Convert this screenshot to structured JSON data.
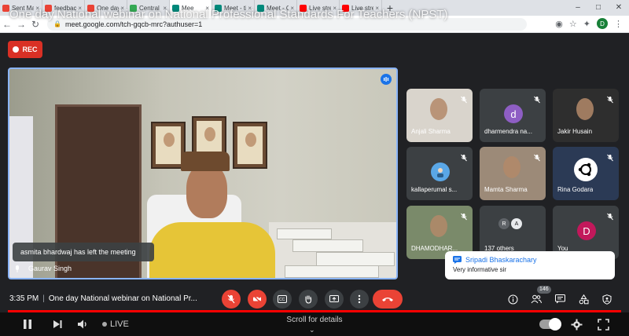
{
  "browser": {
    "tabs": [
      {
        "label": "Sent Ma",
        "color": "#ea4335"
      },
      {
        "label": "feedbac",
        "color": "#ea4335"
      },
      {
        "label": "One day",
        "color": "#ea4335"
      },
      {
        "label": "Central",
        "color": "#34a853"
      },
      {
        "label": "Mee",
        "color": "#00897b"
      },
      {
        "label": "Meet - ti",
        "color": "#00897b"
      },
      {
        "label": "Meet - C",
        "color": "#00897b"
      },
      {
        "label": "Live stre",
        "color": "#ff0000"
      },
      {
        "label": "Live stre",
        "color": "#ff0000"
      }
    ],
    "new_tab": "+",
    "url": "meet.google.com/tch-gqcb-mrc?authuser=1",
    "profile_initial": "D"
  },
  "overlay_title": "One day National webinar on National Professional Standards For Teachers (NPST)",
  "meet": {
    "rec_label": "REC",
    "main_speaker": "Gaurav Singh",
    "toast": "asmita bhardwaj has left the meeting",
    "participants": [
      {
        "name": "Anjali Sharma",
        "kind": "video",
        "tone": "#d9d4cc"
      },
      {
        "name": "dharmendra na...",
        "kind": "avatar",
        "initial": "d",
        "color": "#8e5ec4"
      },
      {
        "name": "Jakir Husain",
        "kind": "video",
        "tone": "#2e2e2e"
      },
      {
        "name": "kallaperumal s...",
        "kind": "avatar-photo",
        "color": "#5aa7e6"
      },
      {
        "name": "Mamta Sharma",
        "kind": "video",
        "tone": "#9c8a78"
      },
      {
        "name": "Rina Godara",
        "kind": "avatar-ubuntu",
        "color": "#2b3a55"
      },
      {
        "name": "DHAMODHAR...",
        "kind": "video",
        "tone": "#7a8a6a"
      },
      {
        "name": "137 others",
        "kind": "others",
        "initials": [
          "R",
          "A"
        ]
      },
      {
        "name": "You",
        "kind": "avatar",
        "initial": "D",
        "color": "#c2185b"
      }
    ],
    "chat": {
      "sender": "Sripadi Bhaskarachary",
      "message": "Very informative sir"
    },
    "bottom": {
      "time": "3:35 PM",
      "meeting_title": "One day National webinar on National Pr...",
      "people_count": "146"
    },
    "colors": {
      "accent": "#1a73e8",
      "danger": "#ea4335",
      "bg": "#202124"
    }
  },
  "youtube": {
    "live_label": "LIVE",
    "scroll_hint": "Scroll for details"
  }
}
